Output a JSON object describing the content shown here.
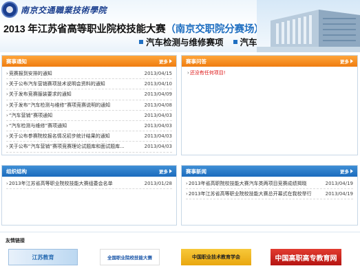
{
  "header": {
    "school_name": "南京交通職業技術學院",
    "title_main": "2013 年江苏省高等职业院校技能大赛",
    "title_sub": "（南京交职院分赛场）",
    "categories": [
      "汽车检测与维修赛项",
      "汽车营销赛项"
    ]
  },
  "notices": {
    "title": "赛事通知",
    "more": "更多",
    "items": [
      {
        "text": "竞赛报到安排的通知",
        "date": "2013/04/15"
      },
      {
        "text": "关于公布汽车营销赛项技术说明会资料的通知",
        "date": "2013/04/10"
      },
      {
        "text": "关于发布竞赛服装要求的通知",
        "date": "2013/04/09"
      },
      {
        "text": "关于发布“汽车检测与维修”赛项竞赛说明的通知",
        "date": "2013/04/08"
      },
      {
        "text": "“汽车营销”赛项通知",
        "date": "2013/04/03"
      },
      {
        "text": "“汽车检测与维修”赛项通知",
        "date": "2013/04/03"
      },
      {
        "text": "关于公布参赛院校报名情况初步统计结果的通知",
        "date": "2013/04/03"
      },
      {
        "text": "关于公布“汽车营销”赛项竞赛理论试题库和面试题库...",
        "date": "2013/04/03"
      }
    ]
  },
  "qa": {
    "title": "赛事问答",
    "more": "更多",
    "items": [
      {
        "text": "还没有任何项目!"
      }
    ]
  },
  "org": {
    "title": "组织结构",
    "more": "更多",
    "items": [
      {
        "text": "2013年江苏省高等职业院校技能大赛组委会名单",
        "date": "2013/01/28"
      }
    ]
  },
  "news": {
    "title": "赛事新闻",
    "more": "更多",
    "items": [
      {
        "text": "2013年省高职院校技能大赛汽车类两项目竞赛成绩揭晓",
        "date": "2013/04/19"
      },
      {
        "text": "2013年江苏省高等职业院校技能大赛总开幕式在我校举行",
        "date": "2013/04/19"
      }
    ]
  },
  "links": {
    "title": "友情链接",
    "items": [
      "江苏教育",
      "全国职业院校技能大赛",
      "中国职业技术教育学会",
      "中国高职高专教育网"
    ]
  },
  "colors": {
    "blue_header": "#1b6bbd",
    "orange_header": "#ef7c10",
    "accent_blue": "#1f6fc1",
    "alert_red": "#dd1111"
  }
}
